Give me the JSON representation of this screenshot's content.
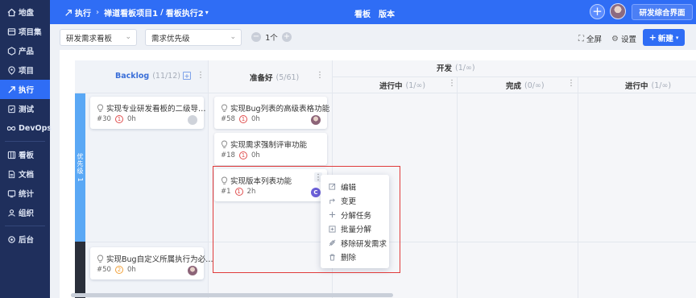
{
  "sidebar": {
    "items": [
      {
        "label": "地盘",
        "icon": "home-icon"
      },
      {
        "label": "项目集",
        "icon": "project-set-icon"
      },
      {
        "label": "产品",
        "icon": "product-icon"
      },
      {
        "label": "项目",
        "icon": "project-icon"
      },
      {
        "label": "执行",
        "icon": "execution-icon",
        "active": true
      },
      {
        "label": "测试",
        "icon": "test-icon"
      },
      {
        "label": "DevOps",
        "icon": "devops-icon"
      },
      {
        "label": "看板",
        "icon": "kanban-icon"
      },
      {
        "label": "文档",
        "icon": "document-icon"
      },
      {
        "label": "统计",
        "icon": "statistics-icon"
      },
      {
        "label": "组织",
        "icon": "organization-icon"
      },
      {
        "label": "后台",
        "icon": "admin-icon"
      }
    ]
  },
  "header": {
    "module": "执行",
    "project": "禅道看板项目1",
    "board": "看板执行2",
    "tabs": [
      "看板",
      "版本"
    ],
    "workspace_button": "研发综合界面"
  },
  "toolbar": {
    "board_type": "研发需求看板",
    "sort": "需求优先级",
    "stepper_value": "1个",
    "fullscreen": "全屏",
    "settings": "设置",
    "new": "新建"
  },
  "board": {
    "columns": {
      "backlog": {
        "name": "Backlog",
        "count": "(11/12)"
      },
      "ready": {
        "name": "准备好",
        "count": "(5/61)"
      },
      "dev": {
        "name": "开发",
        "count": "(1/∞)"
      },
      "in_progress": {
        "name": "进行中",
        "count": "(1/∞)"
      },
      "done": {
        "name": "完成",
        "count": "(0/∞)"
      },
      "in_progress2": {
        "name": "进行中",
        "count": "(1/∞)"
      }
    },
    "lane1": {
      "label": "优先级 1"
    },
    "cards": [
      {
        "title": "实现专业研发看板的二级导…",
        "id": "#30",
        "priority": "1",
        "hours": "0h"
      },
      {
        "title": "实现Bug列表的高级表格功能",
        "id": "#58",
        "priority": "1",
        "hours": "0h"
      },
      {
        "title": "实现需求强制评审功能",
        "id": "#18",
        "priority": "1",
        "hours": "0h"
      },
      {
        "title": "实现版本列表功能",
        "id": "#1",
        "priority": "1",
        "hours": "2h",
        "avatar": "C"
      },
      {
        "title": "实现Bug自定义所属执行为必…",
        "id": "#50",
        "priority": "2",
        "hours": "0h"
      }
    ]
  },
  "context_menu": {
    "items": [
      {
        "label": "编辑",
        "icon": "edit-icon"
      },
      {
        "label": "变更",
        "icon": "change-icon"
      },
      {
        "label": "分解任务",
        "icon": "plus-icon"
      },
      {
        "label": "批量分解",
        "icon": "batch-split-icon"
      },
      {
        "label": "移除研发需求",
        "icon": "remove-link-icon"
      },
      {
        "label": "删除",
        "icon": "trash-icon"
      }
    ]
  },
  "colors": {
    "sidebar": "#1f2f5c",
    "accent": "#2f6df5",
    "lane": "#5aa8f5",
    "priority1": "#e04f4f",
    "priority2": "#f2a23a",
    "highlight": "#e03b3b"
  }
}
